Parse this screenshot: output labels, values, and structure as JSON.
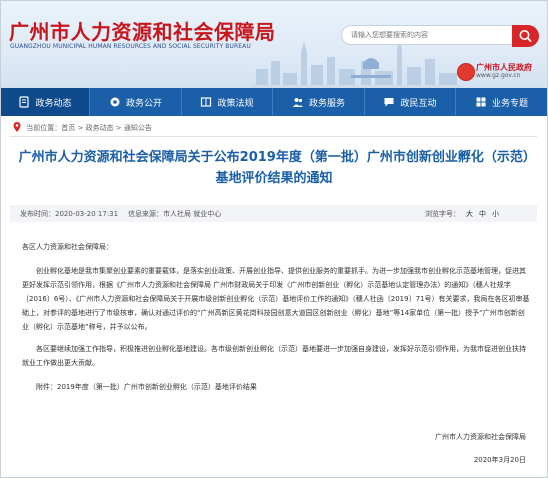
{
  "header": {
    "logo_cn": "广州市人力资源和社会保障局",
    "logo_en": "GUANGZHOU MUNICIPAL HUMAN RESOURCES AND SOCIAL SECURITY BUREAU",
    "search_placeholder": "请输入您想要搜索的内容",
    "gov_name": "广州市人民政府",
    "gov_url": "www.gz.gov.cn"
  },
  "nav": {
    "items": [
      {
        "label": "政务动态",
        "icon": "document-icon"
      },
      {
        "label": "政务公开",
        "icon": "gear-icon"
      },
      {
        "label": "政策法规",
        "icon": "book-icon"
      },
      {
        "label": "政务服务",
        "icon": "people-icon"
      },
      {
        "label": "政民互动",
        "icon": "chat-icon"
      },
      {
        "label": "业务专题",
        "icon": "grid-icon"
      }
    ]
  },
  "breadcrumb": {
    "label": "当前位置：",
    "home": "首页",
    "sep1": " > ",
    "section": "政务动态",
    "sep2": " > ",
    "page": "通知公告"
  },
  "article": {
    "title": "广州市人力资源和社会保障局关于公布2019年度（第一批）广州市创新创业孵化（示范）基地评价结果的通知",
    "published": "发布时间：2020-03-20 17:31",
    "source": "信息来源：市人社局 就业中心",
    "font_size_label": "浏览字号：",
    "font_sizes": [
      "大",
      "中",
      "小"
    ],
    "salutation": "各区人力资源和社会保障局：",
    "para1": "创业孵化基地是我市集聚创业要素的重要载体，是落实创业政策、开展创业指导、提供创业服务的重要抓手。为进一步加强我市创业孵化示范基地管理，促进其更好发挥示范引领作用，根据《广州市人力资源和社会保障局 广州市财政局关于印发〈广州市创新创业（孵化）示范基地认定管理办法〉的通知》（穗人社规字〔2016〕6号）、《广州市人力资源和社会保障局关于开展市级创新创业孵化（示范）基地评价工作的通知》（穗人社函〔2019〕71号）有关要求，我局在各区初审基础上，对参评的基地进行了市级核审，确认对通过评价的“广州高新区黄花岗科技园创意大道园区创新创业（孵化）基地”等14家单位（第一批）授予“广州市创新创业（孵化）示范基地”称号，并予以公布。",
    "para2": "各区要继续加强工作指导，积极推进创业孵化基地建设。各市级创新创业孵化（示范）基地要进一步加强自身建设，发挥好示范引领作用，为我市促进创业扶持就业工作做出更大贡献。",
    "attachment": "附件：2019年度（第一批）广州市创新创业孵化（示范）基地评价结果",
    "signature": "广州市人力资源和社会保障局",
    "date": "2020年3月20日"
  },
  "colors": {
    "brand_red": "#c8161d",
    "nav_blue": "#1a5fa8",
    "title_blue": "#1a5fa8"
  }
}
